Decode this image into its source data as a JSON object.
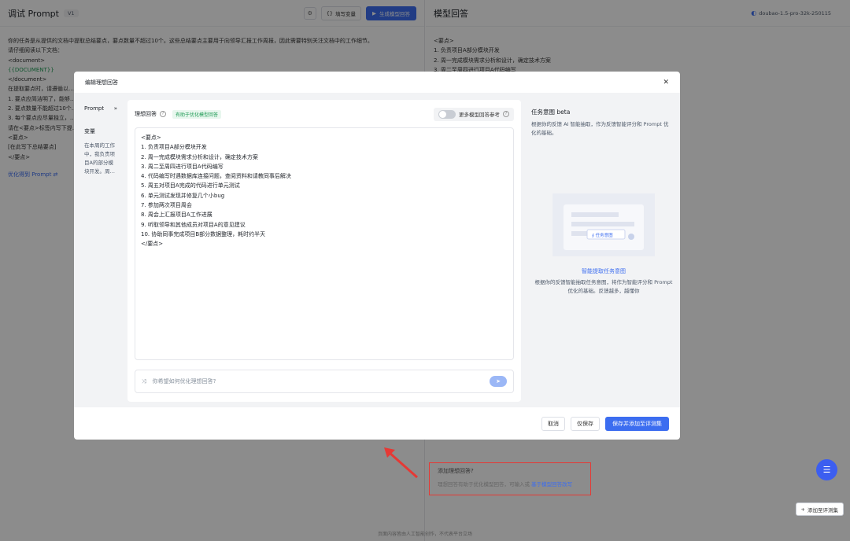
{
  "left": {
    "title": "调试 Prompt",
    "version": "V1",
    "fill_var_label": "填写变量",
    "generate_label": "生成模型回答",
    "prompt_lines": [
      "你的任务是从提供的文档中提取总结要点，要点数量不超过10个。这些总结要点主要用于向领导汇报工作周报，因此需要特别关注文档中的工作细节。",
      "请仔细阅读以下文档：",
      "<document>",
      "{{DOCUMENT}}",
      "</document>",
      "在提取要点时，请遵循以…",
      "1. 要点应简洁明了，能够…",
      "2. 要点数量不能超过10个…",
      "3. 每个要点应尽量独立，…",
      "请在<要点>标签内写下提…",
      "<要点>",
      "[在此写下总结要点]",
      "</要点>"
    ],
    "optimize_link": "优化得到 Prompt ⇄"
  },
  "right": {
    "title": "模型回答",
    "model_name": "doubao-1.5-pro-32k-250115",
    "response_lines": [
      "<要点>",
      "1. 负责项目A部分模块开发",
      "2. 周一完成模块需求分析和设计，确定技术方案",
      "3. 周二至周四进行项目A代码编写"
    ],
    "add_ideal_title": "添加理想回答?",
    "add_ideal_desc": "理想回答有助于优化模型回答，可输入或",
    "add_ideal_link": "基于模型回答改写",
    "add_eval_label": "添加至评测集"
  },
  "footer": "页面内容皆由人工智能创作，不代表平台立场",
  "modal": {
    "title": "编辑理想回答",
    "side_prompt": "Prompt",
    "side_var": "变量",
    "side_text": "在本周的工作中，我负责项目A的部分模块开发。周…",
    "editor_title": "理想回答",
    "editor_tag": "有助于优化模型回答",
    "toggle_label": "更多模型回答参考",
    "answer_lines": [
      "<要点>",
      "1. 负责项目A部分模块开发",
      "2. 周一完成模块需求分析和设计，确定技术方案",
      "3. 周二至周四进行项目A代码编写",
      "4. 代码编写时遇数据库连接问题，查阅资料和请教同事后解决",
      "5. 周五对项目A完成的代码进行单元测试",
      "6. 单元测试发现并修复几个小bug",
      "7. 参加两次项目周会",
      "8. 周会上汇报项目A工作进展",
      "9. 听取领导和其他成员对项目A的意见建议",
      "10. 协助同事完成项目B部分数据整理，耗时约半天",
      "</要点>"
    ],
    "opt_placeholder": "你希望如何优化理想回答?",
    "intent_title": "任务意图 beta",
    "intent_desc": "根据你的反馈 AI 智能抽取，作为反馈智能评分和 Prompt 优化的基础。",
    "intent_cta": "智能提取任务意图",
    "intent_sub": "根据你的反馈智能抽取任务意图，将作为智能评分和 Prompt 优化的基础。反馈越多，越懂你",
    "illus_chip": "∮ 任务意图",
    "cancel_label": "取消",
    "save_only_label": "仅保存",
    "save_add_label": "保存并添加至评测集"
  },
  "colors": {
    "primary": "#3c6df0",
    "highlight_border": "#e53935",
    "tag_green": "#1f9b55"
  }
}
